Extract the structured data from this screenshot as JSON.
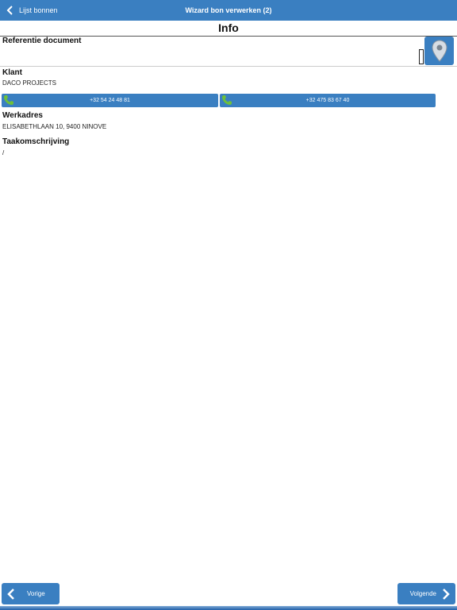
{
  "nav": {
    "back_label": "Lijst bonnen",
    "title": "Wizard bon verwerken (2)"
  },
  "page": {
    "title": "Info"
  },
  "fields": {
    "reference_label": "Referentie document",
    "client_label": "Klant",
    "client_value": "DACO PROJECTS",
    "phones": [
      "+32 54 24 48 81",
      "+32 475 83 67 40"
    ],
    "address_label": "Werkadres",
    "address_value": "ELISABETHLAAN 10, 9400 NINOVE",
    "task_label": "Taakomschrijving",
    "task_value": "/"
  },
  "footer": {
    "prev_label": "Vorige",
    "next_label": "Volgende"
  },
  "colors": {
    "accent": "#3a7fc1",
    "phone_icon": "#6ec03a"
  },
  "icons": {
    "back": "chevron-left-icon",
    "map": "map-pin-icon",
    "phone": "phone-icon",
    "next": "chevron-right-icon"
  }
}
